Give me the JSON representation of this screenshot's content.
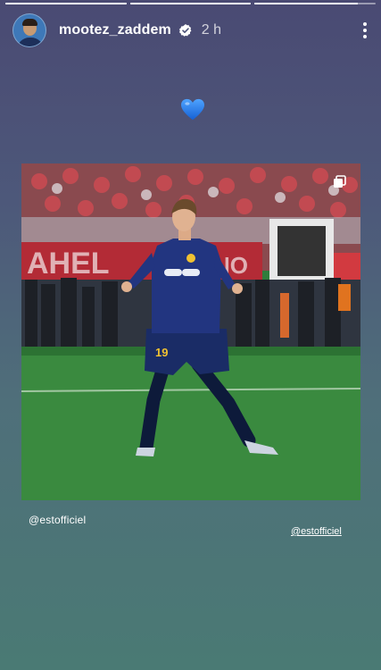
{
  "story": {
    "progress_segments": [
      1.0,
      1.0,
      0.85
    ],
    "username": "mootez_zaddem",
    "verified": true,
    "time_ago": "2 h",
    "sticker_icon": "blue-heart-emoji",
    "post_image": {
      "subject": "football player in navy kit with number 19",
      "jersey_number": "19",
      "banner_text": "AHEL",
      "banner_text_2": "NO"
    },
    "mention_text": "@estofficiel",
    "mention_sticker": "@estofficiel"
  },
  "icons": {
    "more": "more-vertical-icon",
    "verified": "verified-badge-icon",
    "multi": "multiple-posts-icon"
  },
  "colors": {
    "heart": "#1e7be8",
    "bg_top": "#4a4a73",
    "bg_bottom": "#4a7a74"
  }
}
